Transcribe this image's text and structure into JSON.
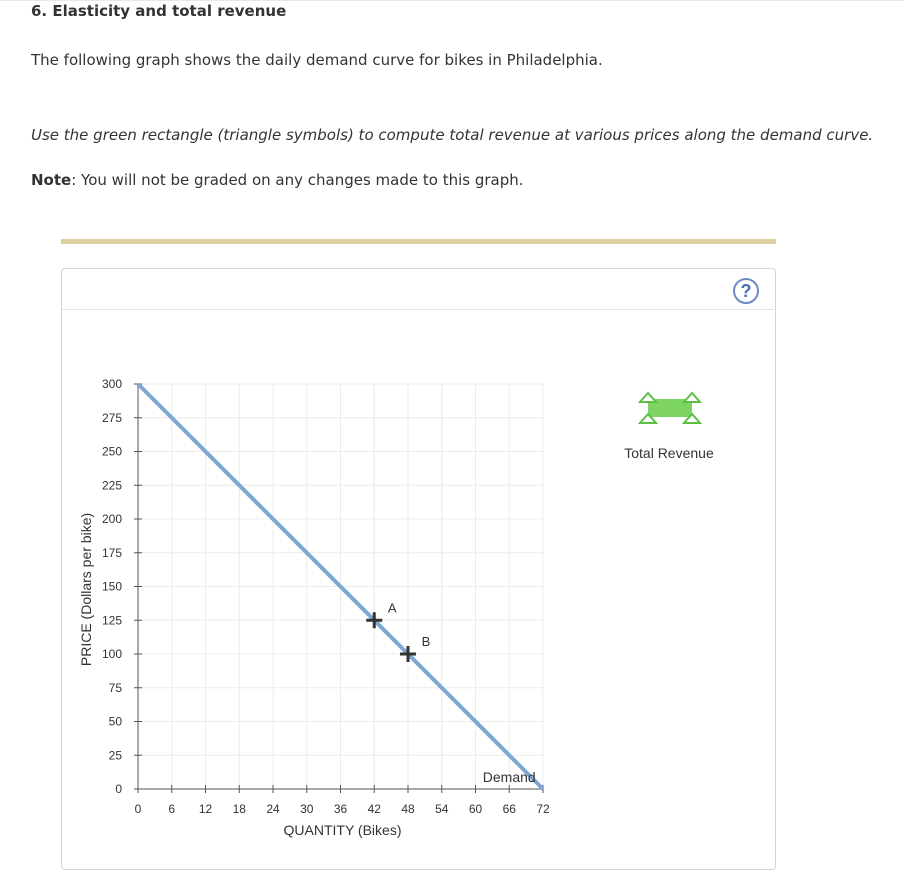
{
  "question": {
    "title": "6. Elasticity and total revenue",
    "intro": "The following graph shows the daily demand curve for bikes in Philadelphia.",
    "instruction": "Use the green rectangle (triangle symbols) to compute total revenue at various prices along the demand curve.",
    "note_label": "Note",
    "note_text": ": You will not be graded on any changes made to this graph."
  },
  "panel": {
    "help_icon": "question-mark-icon",
    "help_label": "?"
  },
  "legend": {
    "tool_label": "Total Revenue",
    "tool_icon": "green-rectangle-triangle-handles",
    "tool_color": "#7ed462",
    "tool_handle_color": "#5cbf45"
  },
  "chart_data": {
    "type": "line",
    "xlabel": "QUANTITY (Bikes)",
    "ylabel": "PRICE (Dollars per bike)",
    "xlim": [
      0,
      72
    ],
    "ylim": [
      0,
      300
    ],
    "xticks": [
      0,
      6,
      12,
      18,
      24,
      30,
      36,
      42,
      48,
      54,
      60,
      66,
      72
    ],
    "yticks": [
      0,
      25,
      50,
      75,
      100,
      125,
      150,
      175,
      200,
      225,
      250,
      275,
      300
    ],
    "grid": true,
    "series": [
      {
        "name": "Demand",
        "color": "#7ea7d4",
        "points": [
          [
            0,
            300
          ],
          [
            72,
            0
          ]
        ]
      }
    ],
    "points": [
      {
        "label": "A",
        "x": 42,
        "y": 125
      },
      {
        "label": "B",
        "x": 48,
        "y": 100
      }
    ],
    "series_label": "Demand"
  }
}
